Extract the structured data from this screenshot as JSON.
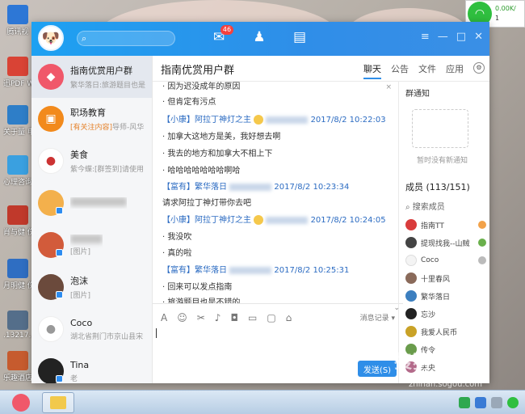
{
  "desktop": {
    "icons": [
      {
        "label": "腾讯视",
        "color": "#2d77d6"
      },
      {
        "label": "迅PDF Word",
        "color": "#d94335"
      },
      {
        "label": "关于量 申总商业",
        "color": "#2e7ec8"
      },
      {
        "label": "心理咨询",
        "color": "#3aa0e0"
      },
      {
        "label": "肖与健 伤所",
        "color": "#c0392b"
      },
      {
        "label": "月明健 伤所",
        "color": "#2f6ec2"
      },
      {
        "label": ".13217..",
        "color": "#546e8a"
      },
      {
        "label": "乐趣酒店 公酒店地",
        "color": "#c65b2e"
      }
    ]
  },
  "network": {
    "speed_up": "0.00K/",
    "speed_down": "1"
  },
  "qq": {
    "search_placeholder": "",
    "message_badge": "46",
    "nav": [
      "message-icon",
      "contacts-icon",
      "apps-icon"
    ],
    "window_controls": [
      "≡",
      "—",
      "□",
      "✕"
    ],
    "conversations": [
      {
        "name": "指南优赏用户群",
        "sub": "繁华落日:旅游题目也是",
        "color": "#f0586a",
        "active": true
      },
      {
        "name": "职场教育",
        "sub_hl": "[有关注内容]",
        "sub": "导师-风华",
        "color": "#f28a1c",
        "active": false
      },
      {
        "name": "美食",
        "sub": "紫今蝶:[群签到]请使用",
        "color": "#ffffff",
        "active": false
      },
      {
        "name": "",
        "sub": "",
        "color": "#b8b8b8",
        "active": false
      },
      {
        "name": "",
        "sub": "[图片]",
        "color": "#d25b3b",
        "active": false
      },
      {
        "name": "泡沫",
        "sub": "[图片]",
        "color": "#6b4a3c",
        "active": false
      },
      {
        "name": "Coco",
        "sub": "湖北省荆门市京山县宋",
        "color": "#ffffff",
        "active": false
      },
      {
        "name": "Tina",
        "sub": "老",
        "color": "#222222",
        "active": false
      },
      {
        "name": "",
        "sub": "",
        "color": "#d9d9d9",
        "active": false
      }
    ],
    "chat": {
      "title": "指南优赏用户群",
      "tabs": [
        "聊天",
        "公告",
        "文件",
        "应用"
      ],
      "messages": [
        {
          "type": "line",
          "text": "· 因为迟没成年的原因"
        },
        {
          "type": "line",
          "text": "· 但肯定有污点"
        },
        {
          "type": "meta",
          "who": "【小康】阿拉丁神灯之主",
          "time": "2017/8/2 10:22:03"
        },
        {
          "type": "line",
          "text": "· 加拿大这地方是美，我好想去啊"
        },
        {
          "type": "line",
          "text": "· 我去的地方和加拿大不相上下"
        },
        {
          "type": "line",
          "text": "· 哈哈哈哈哈哈哈啊哈"
        },
        {
          "type": "meta",
          "who": "【富有】繁华落日",
          "time": "2017/8/2 10:23:34"
        },
        {
          "type": "line",
          "text": "请求阿拉丁神灯带你去吧"
        },
        {
          "type": "meta",
          "who": "【小康】阿拉丁神灯之主",
          "time": "2017/8/2 10:24:05"
        },
        {
          "type": "line",
          "text": "· 我没吹"
        },
        {
          "type": "line",
          "text": "· 真的啦"
        },
        {
          "type": "meta",
          "who": "【富有】繁华落日",
          "time": "2017/8/2 10:25:31"
        },
        {
          "type": "line",
          "text": "· 回来可以发点指南"
        },
        {
          "type": "line",
          "text": "· 旅游题目也是不错的"
        }
      ],
      "history_label": "消息记录 ▾",
      "send_label": "发送(S)"
    },
    "panel": {
      "notice_title": "群通知",
      "notice_empty": "暂时没有新通知",
      "members_title": "成员 (113/151)",
      "search_members": "搜索成员",
      "members": [
        {
          "name": "指南TT",
          "color": "#d93c3c"
        },
        {
          "name": "提现找我--山贼",
          "color": "#444444"
        },
        {
          "name": "Coco",
          "color": "#f4f4f4"
        },
        {
          "name": "十里春风",
          "color": "#8a6a5a"
        },
        {
          "name": "繁华落日",
          "color": "#3c7fbf"
        },
        {
          "name": "忘沙",
          "color": "#222222"
        },
        {
          "name": "我爱人民币",
          "color": "#c9a227"
        },
        {
          "name": "传令",
          "color": "#6a9c4c"
        },
        {
          "name": "未央",
          "color": "#b36a8a"
        }
      ]
    }
  },
  "watermark": {
    "text": "搜狗指南",
    "url": "zhinan.sogou.com"
  }
}
